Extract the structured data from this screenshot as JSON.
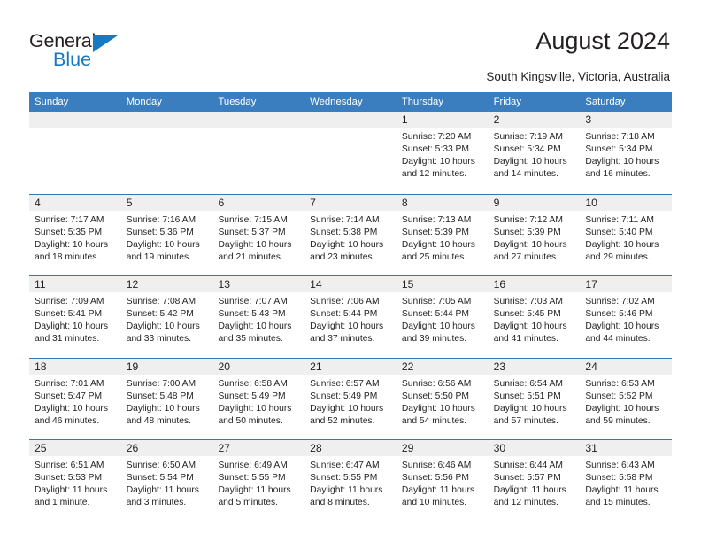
{
  "logo": {
    "word_one": "General",
    "word_two": "Blue",
    "triangle_color": "#1878c0"
  },
  "header": {
    "title": "August 2024",
    "subtitle": "South Kingsville, Victoria, Australia"
  },
  "colors": {
    "header_blue": "#3a7ebf",
    "row_divider_blue": "#2f79b5",
    "day_band_gray": "#efefef",
    "text": "#231f20"
  },
  "calendar": {
    "weekdays": [
      "Sunday",
      "Monday",
      "Tuesday",
      "Wednesday",
      "Thursday",
      "Friday",
      "Saturday"
    ],
    "weeks": [
      [
        {
          "day": "",
          "lines": []
        },
        {
          "day": "",
          "lines": []
        },
        {
          "day": "",
          "lines": []
        },
        {
          "day": "",
          "lines": []
        },
        {
          "day": "1",
          "lines": [
            "Sunrise: 7:20 AM",
            "Sunset: 5:33 PM",
            "Daylight: 10 hours and 12 minutes."
          ]
        },
        {
          "day": "2",
          "lines": [
            "Sunrise: 7:19 AM",
            "Sunset: 5:34 PM",
            "Daylight: 10 hours and 14 minutes."
          ]
        },
        {
          "day": "3",
          "lines": [
            "Sunrise: 7:18 AM",
            "Sunset: 5:34 PM",
            "Daylight: 10 hours and 16 minutes."
          ]
        }
      ],
      [
        {
          "day": "4",
          "lines": [
            "Sunrise: 7:17 AM",
            "Sunset: 5:35 PM",
            "Daylight: 10 hours and 18 minutes."
          ]
        },
        {
          "day": "5",
          "lines": [
            "Sunrise: 7:16 AM",
            "Sunset: 5:36 PM",
            "Daylight: 10 hours and 19 minutes."
          ]
        },
        {
          "day": "6",
          "lines": [
            "Sunrise: 7:15 AM",
            "Sunset: 5:37 PM",
            "Daylight: 10 hours and 21 minutes."
          ]
        },
        {
          "day": "7",
          "lines": [
            "Sunrise: 7:14 AM",
            "Sunset: 5:38 PM",
            "Daylight: 10 hours and 23 minutes."
          ]
        },
        {
          "day": "8",
          "lines": [
            "Sunrise: 7:13 AM",
            "Sunset: 5:39 PM",
            "Daylight: 10 hours and 25 minutes."
          ]
        },
        {
          "day": "9",
          "lines": [
            "Sunrise: 7:12 AM",
            "Sunset: 5:39 PM",
            "Daylight: 10 hours and 27 minutes."
          ]
        },
        {
          "day": "10",
          "lines": [
            "Sunrise: 7:11 AM",
            "Sunset: 5:40 PM",
            "Daylight: 10 hours and 29 minutes."
          ]
        }
      ],
      [
        {
          "day": "11",
          "lines": [
            "Sunrise: 7:09 AM",
            "Sunset: 5:41 PM",
            "Daylight: 10 hours and 31 minutes."
          ]
        },
        {
          "day": "12",
          "lines": [
            "Sunrise: 7:08 AM",
            "Sunset: 5:42 PM",
            "Daylight: 10 hours and 33 minutes."
          ]
        },
        {
          "day": "13",
          "lines": [
            "Sunrise: 7:07 AM",
            "Sunset: 5:43 PM",
            "Daylight: 10 hours and 35 minutes."
          ]
        },
        {
          "day": "14",
          "lines": [
            "Sunrise: 7:06 AM",
            "Sunset: 5:44 PM",
            "Daylight: 10 hours and 37 minutes."
          ]
        },
        {
          "day": "15",
          "lines": [
            "Sunrise: 7:05 AM",
            "Sunset: 5:44 PM",
            "Daylight: 10 hours and 39 minutes."
          ]
        },
        {
          "day": "16",
          "lines": [
            "Sunrise: 7:03 AM",
            "Sunset: 5:45 PM",
            "Daylight: 10 hours and 41 minutes."
          ]
        },
        {
          "day": "17",
          "lines": [
            "Sunrise: 7:02 AM",
            "Sunset: 5:46 PM",
            "Daylight: 10 hours and 44 minutes."
          ]
        }
      ],
      [
        {
          "day": "18",
          "lines": [
            "Sunrise: 7:01 AM",
            "Sunset: 5:47 PM",
            "Daylight: 10 hours and 46 minutes."
          ]
        },
        {
          "day": "19",
          "lines": [
            "Sunrise: 7:00 AM",
            "Sunset: 5:48 PM",
            "Daylight: 10 hours and 48 minutes."
          ]
        },
        {
          "day": "20",
          "lines": [
            "Sunrise: 6:58 AM",
            "Sunset: 5:49 PM",
            "Daylight: 10 hours and 50 minutes."
          ]
        },
        {
          "day": "21",
          "lines": [
            "Sunrise: 6:57 AM",
            "Sunset: 5:49 PM",
            "Daylight: 10 hours and 52 minutes."
          ]
        },
        {
          "day": "22",
          "lines": [
            "Sunrise: 6:56 AM",
            "Sunset: 5:50 PM",
            "Daylight: 10 hours and 54 minutes."
          ]
        },
        {
          "day": "23",
          "lines": [
            "Sunrise: 6:54 AM",
            "Sunset: 5:51 PM",
            "Daylight: 10 hours and 57 minutes."
          ]
        },
        {
          "day": "24",
          "lines": [
            "Sunrise: 6:53 AM",
            "Sunset: 5:52 PM",
            "Daylight: 10 hours and 59 minutes."
          ]
        }
      ],
      [
        {
          "day": "25",
          "lines": [
            "Sunrise: 6:51 AM",
            "Sunset: 5:53 PM",
            "Daylight: 11 hours and 1 minute."
          ]
        },
        {
          "day": "26",
          "lines": [
            "Sunrise: 6:50 AM",
            "Sunset: 5:54 PM",
            "Daylight: 11 hours and 3 minutes."
          ]
        },
        {
          "day": "27",
          "lines": [
            "Sunrise: 6:49 AM",
            "Sunset: 5:55 PM",
            "Daylight: 11 hours and 5 minutes."
          ]
        },
        {
          "day": "28",
          "lines": [
            "Sunrise: 6:47 AM",
            "Sunset: 5:55 PM",
            "Daylight: 11 hours and 8 minutes."
          ]
        },
        {
          "day": "29",
          "lines": [
            "Sunrise: 6:46 AM",
            "Sunset: 5:56 PM",
            "Daylight: 11 hours and 10 minutes."
          ]
        },
        {
          "day": "30",
          "lines": [
            "Sunrise: 6:44 AM",
            "Sunset: 5:57 PM",
            "Daylight: 11 hours and 12 minutes."
          ]
        },
        {
          "day": "31",
          "lines": [
            "Sunrise: 6:43 AM",
            "Sunset: 5:58 PM",
            "Daylight: 11 hours and 15 minutes."
          ]
        }
      ]
    ]
  }
}
